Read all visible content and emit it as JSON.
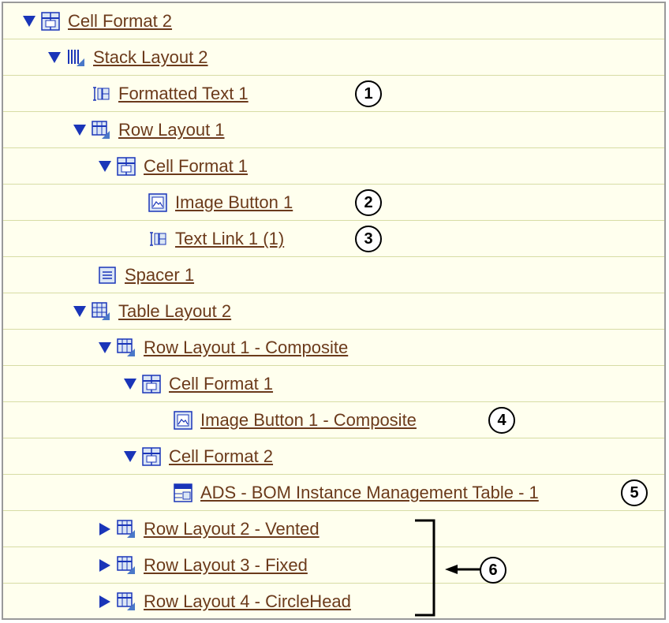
{
  "tree": {
    "items": [
      {
        "label": "Cell Format 2",
        "icon": "cell-format-icon",
        "toggle": "expanded"
      },
      {
        "label": "Stack Layout 2",
        "icon": "stack-layout-icon",
        "toggle": "expanded"
      },
      {
        "label": "Formatted Text 1",
        "icon": "text-component-icon",
        "toggle": "none"
      },
      {
        "label": "Row Layout 1",
        "icon": "row-layout-icon",
        "toggle": "expanded"
      },
      {
        "label": "Cell Format 1",
        "icon": "cell-format-icon",
        "toggle": "expanded"
      },
      {
        "label": "Image Button 1",
        "icon": "image-button-icon",
        "toggle": "none"
      },
      {
        "label": "Text Link 1 (1)",
        "icon": "text-component-icon",
        "toggle": "none"
      },
      {
        "label": "Spacer 1",
        "icon": "spacer-icon",
        "toggle": "none"
      },
      {
        "label": "Table Layout 2",
        "icon": "table-layout-icon",
        "toggle": "expanded"
      },
      {
        "label": "Row Layout 1 - Composite",
        "icon": "row-layout-icon",
        "toggle": "expanded"
      },
      {
        "label": "Cell Format 1",
        "icon": "cell-format-icon",
        "toggle": "expanded"
      },
      {
        "label": "Image Button 1 - Composite",
        "icon": "image-button-icon",
        "toggle": "none"
      },
      {
        "label": "Cell Format 2",
        "icon": "cell-format-icon",
        "toggle": "expanded"
      },
      {
        "label": "ADS - BOM Instance Management Table - 1",
        "icon": "table-component-icon",
        "toggle": "none"
      },
      {
        "label": "Row Layout 2 - Vented",
        "icon": "row-layout-icon",
        "toggle": "collapsed"
      },
      {
        "label": "Row Layout 3 - Fixed",
        "icon": "row-layout-icon",
        "toggle": "collapsed"
      },
      {
        "label": "Row Layout 4 - CircleHead",
        "icon": "row-layout-icon",
        "toggle": "collapsed"
      }
    ]
  },
  "callouts": [
    "1",
    "2",
    "3",
    "4",
    "5",
    "6"
  ],
  "colors": {
    "background": "#ffffee",
    "row_line": "#d7dca5",
    "link": "#6b3a1b",
    "toggle": "#1a35b8",
    "border": "#9a9a9a"
  }
}
